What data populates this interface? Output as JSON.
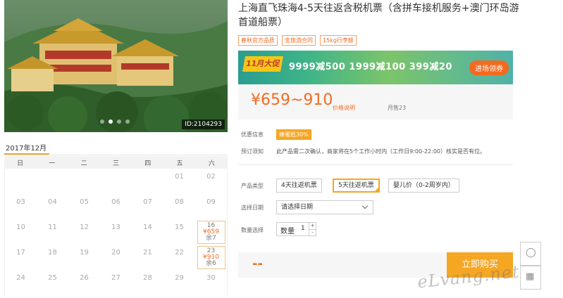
{
  "gallery": {
    "image_alt": "海边寺庙建筑",
    "image_id": "ID:2104293",
    "dots": 4,
    "active_dot": 2
  },
  "calendar": {
    "month_label": "2017年12月",
    "weekdays": [
      "日",
      "一",
      "二",
      "三",
      "四",
      "五",
      "六"
    ],
    "rows": [
      [
        "",
        "",
        "",
        "",
        "",
        "01",
        "02"
      ],
      [
        "03",
        "04",
        "05",
        "06",
        "07",
        "08",
        "09"
      ],
      [
        "10",
        "11",
        "12",
        "13",
        "14",
        "15",
        "16"
      ],
      [
        "17",
        "18",
        "19",
        "20",
        "21",
        "22",
        "23"
      ],
      [
        "24",
        "25",
        "26",
        "27",
        "28",
        "29",
        "30"
      ]
    ],
    "priced": {
      "16": {
        "price": "¥659",
        "stock": "余7"
      },
      "23": {
        "price": "¥910",
        "stock": "余6"
      }
    }
  },
  "product": {
    "title": "上海直飞珠海4-5天往返含税机票（含拼车接机服务+澳门环岛游首道船票）",
    "tags": [
      "春秋官方品质",
      "金旅游合同",
      "15kg行李额"
    ]
  },
  "banner": {
    "badge": "11月大促",
    "offers": [
      "9999减500",
      "1999减100",
      "399减20"
    ],
    "cta": "进场领券"
  },
  "price": {
    "range": "¥659~910",
    "note": "价格说明",
    "monthly_sales": "月售23"
  },
  "promo": {
    "label": "优惠信息",
    "badge": "蜂蜜抵30%"
  },
  "notice": {
    "label": "预订须知",
    "text": "此产品需二次确认，商家将在5个工作小时内（工作日9:00-22:00）核实是否有位。"
  },
  "product_type": {
    "label": "产品类型",
    "options": [
      "4天往返机票",
      "5天往返机票",
      "婴儿价（0-2周岁内）"
    ],
    "selected_index": 1
  },
  "date_select": {
    "label": "选择日期",
    "placeholder": "请选择日期"
  },
  "quantity": {
    "label": "数量选择",
    "field_label": "数量",
    "value": "1",
    "plus": "+",
    "minus": "-"
  },
  "buy": {
    "price_placeholder": "--",
    "button": "立即购买"
  },
  "sidebar": {
    "collect_icon": "◯",
    "qr_icon": "▦"
  },
  "watermark": "eLvang.net",
  "colors": {
    "accent": "#f36b21",
    "secondary": "#f5a623"
  }
}
